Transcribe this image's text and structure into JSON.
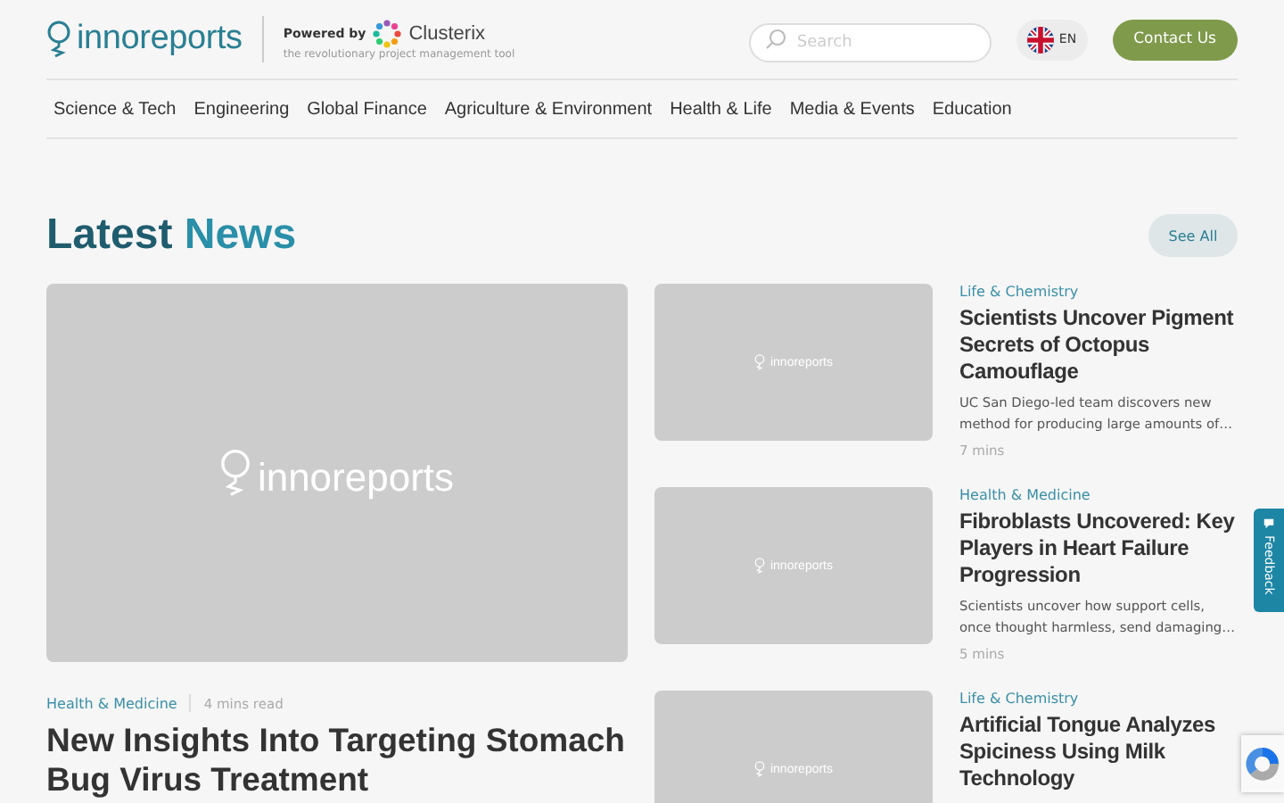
{
  "header": {
    "logo": "innoreports",
    "powered_by": "Powered by",
    "partner": "Clusterix",
    "partner_tagline": "the revolutionary project management tool",
    "search": {
      "placeholder": "Search"
    },
    "language": "EN",
    "contact_button": "Contact Us"
  },
  "nav": [
    "Science & Tech",
    "Engineering",
    "Global Finance",
    "Agriculture & Environment",
    "Health & Life",
    "Media & Events",
    "Education"
  ],
  "section": {
    "title_part1": "Latest",
    "title_part2": "News",
    "see_all": "See All"
  },
  "featured": {
    "image_label": "innoreports",
    "category": "Health & Medicine",
    "read_time": "4 mins read",
    "title": "New Insights Into Targeting Stomach Bug Virus Treatment"
  },
  "articles": [
    {
      "image_label": "innoreports",
      "category": "Life & Chemistry",
      "title": "Scientists Uncover Pigment Secrets of Octopus Camouflage",
      "summary": "UC San Diego-led team discovers new method for producing large amounts of…",
      "read_time": "7 mins"
    },
    {
      "image_label": "innoreports",
      "category": "Health & Medicine",
      "title": "Fibroblasts Uncovered: Key Players in Heart Failure Progression",
      "summary": "Scientists uncover how support cells, once thought harmless, send damaging…",
      "read_time": "5 mins"
    },
    {
      "image_label": "innoreports",
      "category": "Life & Chemistry",
      "title": "Artificial Tongue Analyzes Spiciness Using Milk Technology"
    }
  ],
  "feedback_tab": "Feedback"
}
